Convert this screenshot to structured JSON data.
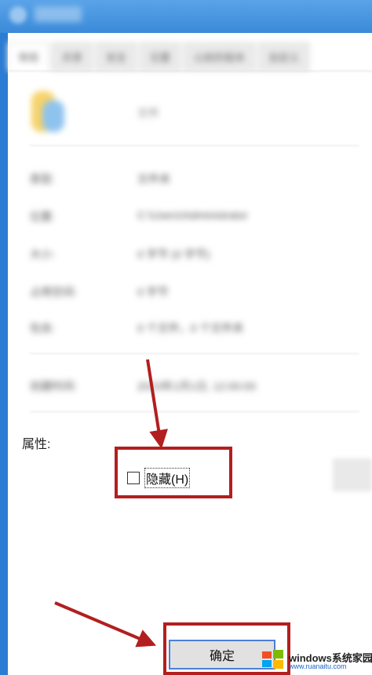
{
  "dialog": {
    "tabs": [
      "常规",
      "共享",
      "安全",
      "位置",
      "以前的版本",
      "自定义"
    ],
    "file_name": "文件",
    "rows": [
      {
        "label": "类型:",
        "value": "文件夹"
      },
      {
        "label": "位置:",
        "value": "C:\\Users\\Administrator"
      },
      {
        "label": "大小:",
        "value": "0 字节 (0 字节)"
      },
      {
        "label": "占用空间:",
        "value": "0 字节"
      },
      {
        "label": "包含:",
        "value": "0 个文件，0 个文件夹"
      },
      {
        "label": "创建时间:",
        "value": "2023年1月1日, 12:00:00"
      }
    ],
    "attributes_label": "属性:",
    "hidden_checkbox": {
      "label": "隐藏(H)",
      "checked": false
    },
    "ok_button": "确定"
  },
  "watermark": {
    "text": "windows系统家园",
    "url": "www.ruanaitu.com"
  },
  "colors": {
    "window_frame": "#2b7cd3",
    "highlight": "#b21f1f",
    "ok_border": "#4d7fd6"
  }
}
